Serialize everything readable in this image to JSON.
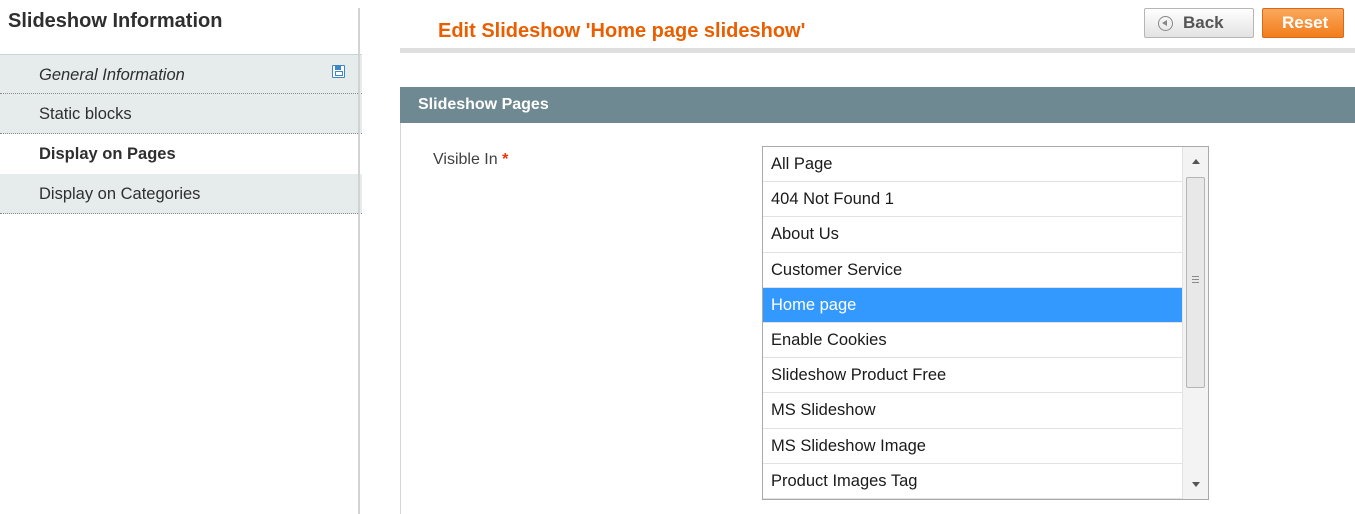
{
  "sidebar": {
    "title": "Slideshow Information",
    "tabs": [
      {
        "label": "General Information",
        "icon": "save-icon"
      },
      {
        "label": "Static blocks"
      },
      {
        "label": "Display on Pages",
        "active": true
      },
      {
        "label": "Display on Categories"
      }
    ]
  },
  "header": {
    "title": "Edit Slideshow 'Home page slideshow'",
    "back_label": "Back",
    "reset_label": "Reset"
  },
  "section": {
    "title": "Slideshow Pages",
    "field_label": "Visible In",
    "required_mark": "*",
    "options": [
      "All Page",
      "404 Not Found 1",
      "About Us",
      "Customer Service",
      "Home page",
      "Enable Cookies",
      "Slideshow Product Free",
      "MS Slideshow",
      "MS Slideshow Image",
      "Product Images Tag"
    ],
    "selected": "Home page"
  },
  "colors": {
    "title_orange": "#eb5e00",
    "section_header": "#6f8992",
    "selected_option": "#3399ff",
    "reset_button": "#f27d1b"
  }
}
